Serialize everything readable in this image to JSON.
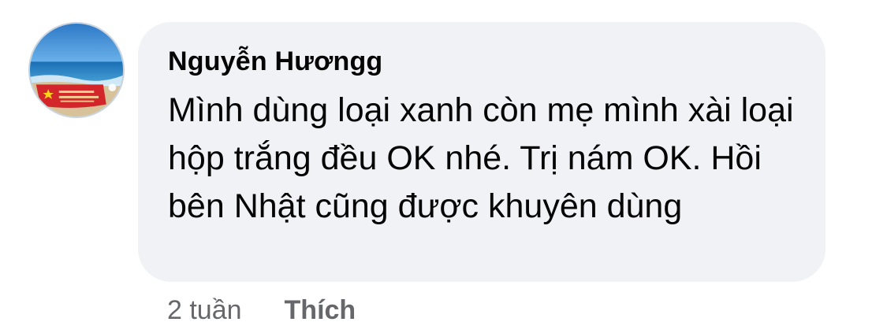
{
  "comment": {
    "author": "Nguyễn Hươngg",
    "text": "Mình dùng loại xanh còn mẹ mình xài loại hộp trắng đều OK nhé. Trị nám OK. Hồi bên Nhật cũng được khuyên dùng",
    "time": "2 tuần",
    "like_label": "Thích",
    "avatar_icon": "beach-photo-avatar"
  },
  "colors": {
    "bubble_bg": "#f0f2f5",
    "text": "#050505",
    "meta": "#65676b"
  }
}
